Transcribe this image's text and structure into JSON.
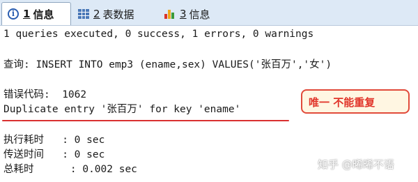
{
  "tabs": [
    {
      "num": "1",
      "label": "信息",
      "icon": "info-icon",
      "active": true
    },
    {
      "num": "2",
      "label": "表数据",
      "icon": "table-icon",
      "active": false
    },
    {
      "num": "3",
      "label": "信息",
      "icon": "chart-icon",
      "active": false
    }
  ],
  "output": {
    "summary": "1 queries executed, 0 success, 1 errors, 0 warnings",
    "query": "查询: INSERT INTO emp3 (ename,sex) VALUES('张百万','女')",
    "error_code": "错误代码:  1062",
    "error_message": "Duplicate entry '张百万' for key 'ename'",
    "exec_time": "执行耗时   : 0 sec",
    "transfer_time": "传送时间   : 0 sec",
    "total_time": "总耗时      : 0.002 sec"
  },
  "annotation": {
    "text": "唯一 不能重复"
  },
  "watermark": "知乎 @晞晞不语",
  "colors": {
    "tabbar": "#dde9f6",
    "annotation_border": "#e14a3a",
    "annotation_text": "#e1352a",
    "underline": "#d93030"
  }
}
